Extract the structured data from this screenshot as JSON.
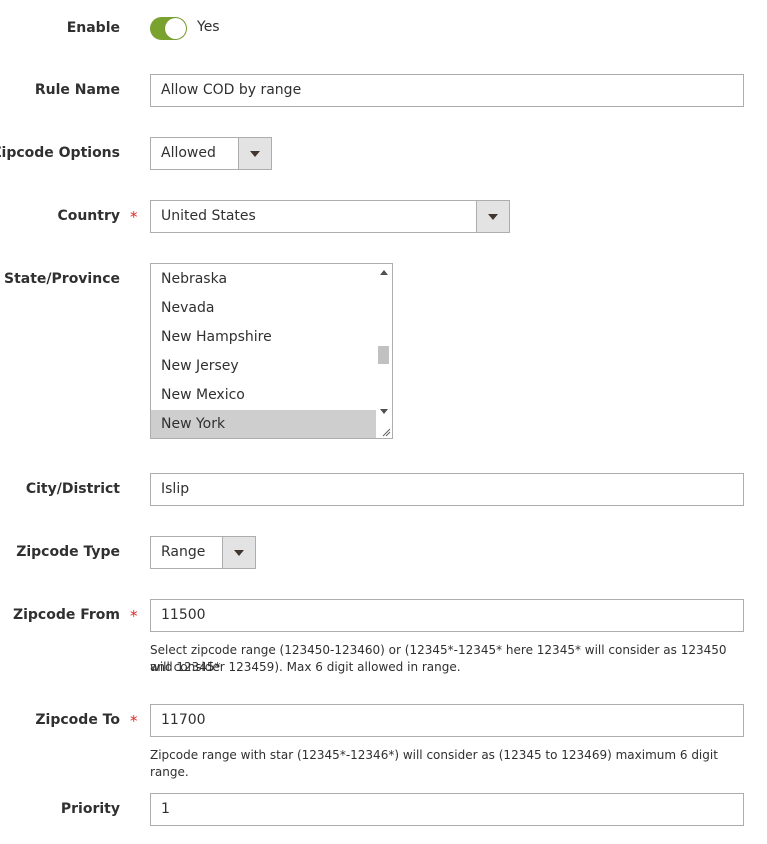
{
  "enable": {
    "label": "Enable",
    "state_text": "Yes",
    "on": true,
    "color": "#79a22e"
  },
  "rule_name": {
    "label": "Rule Name",
    "value": "Allow COD by range"
  },
  "zipcode_options": {
    "label": "Zipcode Options",
    "value": "Allowed"
  },
  "country": {
    "label": "Country",
    "value": "United States",
    "required_mark": "*"
  },
  "state_province": {
    "label": "State/Province",
    "options": [
      "Nebraska",
      "Nevada",
      "New Hampshire",
      "New Jersey",
      "New Mexico",
      "New York"
    ],
    "selected": "New York"
  },
  "city": {
    "label": "City/District",
    "value": "Islip"
  },
  "zipcode_type": {
    "label": "Zipcode Type",
    "value": "Range"
  },
  "zipcode_from": {
    "label": "Zipcode From",
    "value": "11500",
    "required_mark": "*",
    "note_line1": "Select zipcode range (123450-123460) or (12345*-12345* here 12345* will consider as 123450 and 12345*",
    "note_line2": "will consider 123459). Max 6 digit allowed in range."
  },
  "zipcode_to": {
    "label": "Zipcode To",
    "value": "11700",
    "required_mark": "*",
    "note": "Zipcode range with star (12345*-12346*) will consider as (12345 to 123469) maximum 6 digit range."
  },
  "priority": {
    "label": "Priority",
    "value": "1"
  },
  "colors": {
    "required": "#e22626",
    "selected_row": "#cecece",
    "border": "#adadad"
  }
}
